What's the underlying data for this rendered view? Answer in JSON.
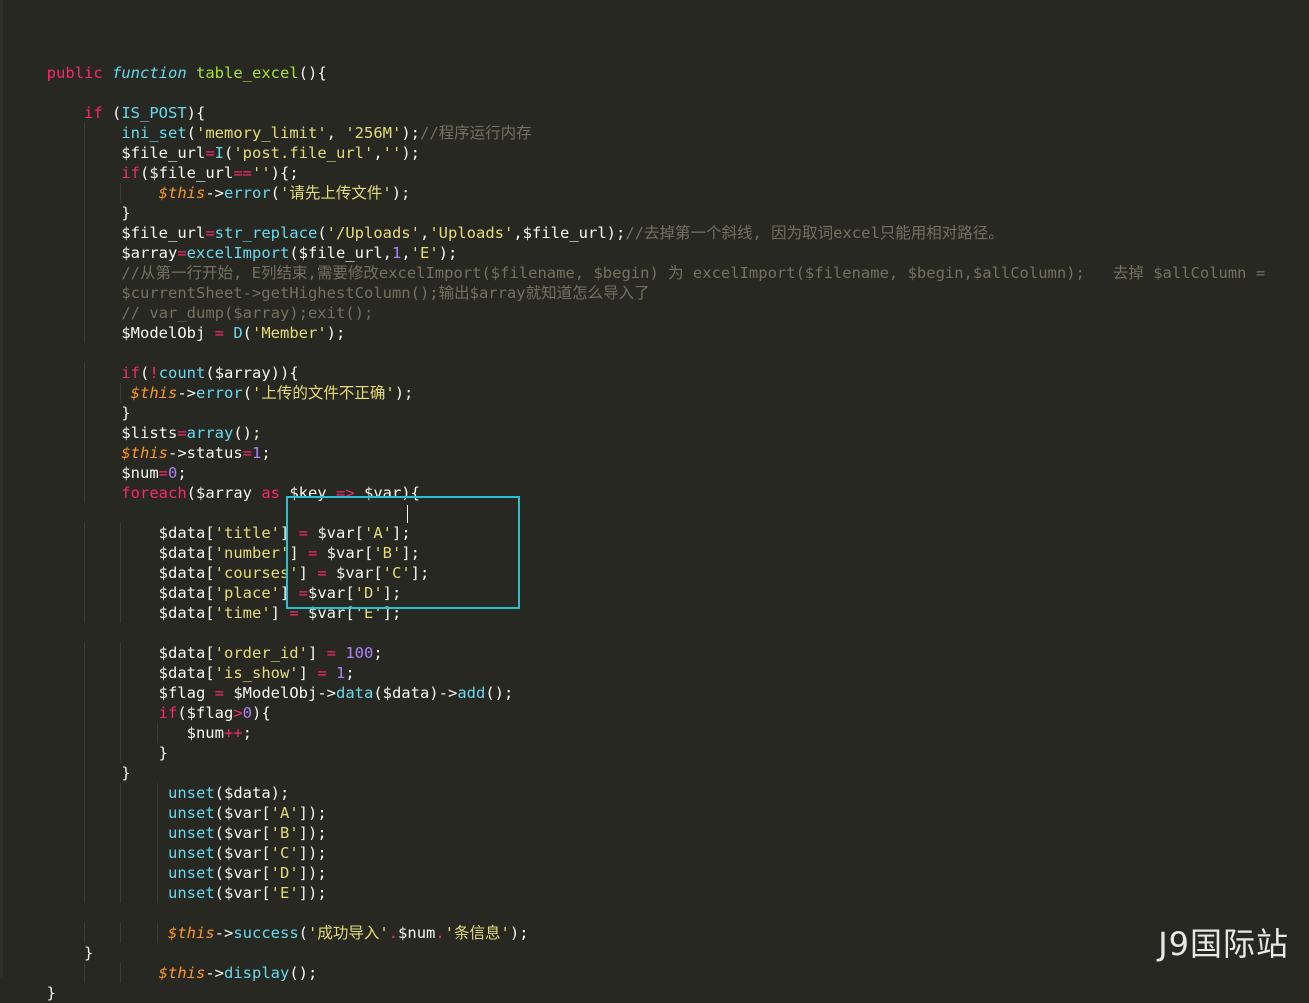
{
  "code_lines": [
    [],
    [
      [
        "kw",
        "public "
      ],
      [
        "fi",
        "function "
      ],
      [
        "def",
        "table_excel"
      ],
      [
        "txt",
        "(){"
      ]
    ],
    [],
    [
      [
        "txt",
        "    "
      ],
      [
        "kw",
        "if "
      ],
      [
        "txt",
        "("
      ],
      [
        "fn",
        "IS_POST"
      ],
      [
        "txt",
        "){"
      ]
    ],
    [
      [
        "txt",
        "        "
      ],
      [
        "fn",
        "ini_set"
      ],
      [
        "txt",
        "("
      ],
      [
        "str",
        "'memory_limit'"
      ],
      [
        "txt",
        ", "
      ],
      [
        "str",
        "'256M'"
      ],
      [
        "txt",
        ");"
      ],
      [
        "cmt",
        "//程序运行内存"
      ]
    ],
    [
      [
        "txt",
        "        $file_url"
      ],
      [
        "kw",
        "="
      ],
      [
        "fn",
        "I"
      ],
      [
        "txt",
        "("
      ],
      [
        "str",
        "'post.file_url'"
      ],
      [
        "txt",
        ","
      ],
      [
        "str",
        "''"
      ],
      [
        "txt",
        ");"
      ]
    ],
    [
      [
        "txt",
        "        "
      ],
      [
        "kw",
        "if"
      ],
      [
        "txt",
        "($file_url"
      ],
      [
        "kw",
        "=="
      ],
      [
        "str",
        "''"
      ],
      [
        "txt",
        "){;"
      ]
    ],
    [
      [
        "txt",
        "            "
      ],
      [
        "thi",
        "$this"
      ],
      [
        "txt",
        "->"
      ],
      [
        "fn",
        "error"
      ],
      [
        "txt",
        "("
      ],
      [
        "str",
        "'请先上传文件'"
      ],
      [
        "txt",
        ");"
      ]
    ],
    [
      [
        "txt",
        "        }"
      ]
    ],
    [
      [
        "txt",
        "        $file_url"
      ],
      [
        "kw",
        "="
      ],
      [
        "fn",
        "str_replace"
      ],
      [
        "txt",
        "("
      ],
      [
        "str",
        "'/Uploads'"
      ],
      [
        "txt",
        ","
      ],
      [
        "str",
        "'Uploads'"
      ],
      [
        "txt",
        ",$file_url);"
      ],
      [
        "cmt",
        "//去掉第一个斜线, 因为取词excel只能用相对路径。"
      ]
    ],
    [
      [
        "txt",
        "        $array"
      ],
      [
        "kw",
        "="
      ],
      [
        "fn",
        "excelImport"
      ],
      [
        "txt",
        "($file_url,"
      ],
      [
        "num",
        "1"
      ],
      [
        "txt",
        ","
      ],
      [
        "str",
        "'E'"
      ],
      [
        "txt",
        ");"
      ]
    ],
    [
      [
        "txt",
        "        "
      ],
      [
        "cmt",
        "//从第一行开始, E列结束,需要修改excelImport($filename, $begin) 为 excelImport($filename, $begin,$allColumn);   去掉 $allColumn ="
      ]
    ],
    [
      [
        "txt",
        "        "
      ],
      [
        "cmt",
        "$currentSheet->getHighestColumn();输出$array就知道怎么导入了"
      ]
    ],
    [
      [
        "txt",
        "        "
      ],
      [
        "cmt",
        "// var_dump($array);exit();"
      ]
    ],
    [
      [
        "txt",
        "        $ModelObj "
      ],
      [
        "kw",
        "= "
      ],
      [
        "fn",
        "D"
      ],
      [
        "txt",
        "("
      ],
      [
        "str",
        "'Member'"
      ],
      [
        "txt",
        ");"
      ]
    ],
    [],
    [
      [
        "txt",
        "        "
      ],
      [
        "kw",
        "if"
      ],
      [
        "txt",
        "("
      ],
      [
        "kw",
        "!"
      ],
      [
        "fn",
        "count"
      ],
      [
        "txt",
        "($array)){"
      ]
    ],
    [
      [
        "txt",
        "         "
      ],
      [
        "thi",
        "$this"
      ],
      [
        "txt",
        "->"
      ],
      [
        "fn",
        "error"
      ],
      [
        "txt",
        "("
      ],
      [
        "str",
        "'上传的文件不正确'"
      ],
      [
        "txt",
        ");"
      ]
    ],
    [
      [
        "txt",
        "        }"
      ]
    ],
    [
      [
        "txt",
        "        $lists"
      ],
      [
        "kw",
        "="
      ],
      [
        "fn",
        "array"
      ],
      [
        "txt",
        "();"
      ]
    ],
    [
      [
        "txt",
        "        "
      ],
      [
        "thi",
        "$this"
      ],
      [
        "txt",
        "->status"
      ],
      [
        "kw",
        "="
      ],
      [
        "num",
        "1"
      ],
      [
        "txt",
        ";"
      ]
    ],
    [
      [
        "txt",
        "        $num"
      ],
      [
        "kw",
        "="
      ],
      [
        "num",
        "0"
      ],
      [
        "txt",
        ";"
      ]
    ],
    [
      [
        "txt",
        "        "
      ],
      [
        "kw",
        "foreach"
      ],
      [
        "txt",
        "($array "
      ],
      [
        "kw",
        "as "
      ],
      [
        "txt",
        "$key "
      ],
      [
        "kw",
        "=> "
      ],
      [
        "txt",
        "$var){"
      ]
    ],
    [],
    [
      [
        "txt",
        "            $data["
      ],
      [
        "str",
        "'title'"
      ],
      [
        "txt",
        "] "
      ],
      [
        "kw",
        "= "
      ],
      [
        "txt",
        "$var["
      ],
      [
        "str",
        "'A'"
      ],
      [
        "txt",
        "];"
      ]
    ],
    [
      [
        "txt",
        "            $data["
      ],
      [
        "str",
        "'number'"
      ],
      [
        "txt",
        "] "
      ],
      [
        "kw",
        "= "
      ],
      [
        "txt",
        "$var["
      ],
      [
        "str",
        "'B'"
      ],
      [
        "txt",
        "];"
      ]
    ],
    [
      [
        "txt",
        "            $data["
      ],
      [
        "str",
        "'courses'"
      ],
      [
        "txt",
        "] "
      ],
      [
        "kw",
        "= "
      ],
      [
        "txt",
        "$var["
      ],
      [
        "str",
        "'C'"
      ],
      [
        "txt",
        "];"
      ]
    ],
    [
      [
        "txt",
        "            $data["
      ],
      [
        "str",
        "'place'"
      ],
      [
        "txt",
        "] "
      ],
      [
        "kw",
        "="
      ],
      [
        "txt",
        "$var["
      ],
      [
        "str",
        "'D'"
      ],
      [
        "txt",
        "];"
      ]
    ],
    [
      [
        "txt",
        "            $data["
      ],
      [
        "str",
        "'time'"
      ],
      [
        "txt",
        "] "
      ],
      [
        "kw",
        "= "
      ],
      [
        "txt",
        "$var["
      ],
      [
        "str",
        "'E'"
      ],
      [
        "txt",
        "];"
      ]
    ],
    [],
    [
      [
        "txt",
        "            $data["
      ],
      [
        "str",
        "'order_id'"
      ],
      [
        "txt",
        "] "
      ],
      [
        "kw",
        "= "
      ],
      [
        "num",
        "100"
      ],
      [
        "txt",
        ";"
      ]
    ],
    [
      [
        "txt",
        "            $data["
      ],
      [
        "str",
        "'is_show'"
      ],
      [
        "txt",
        "] "
      ],
      [
        "kw",
        "= "
      ],
      [
        "num",
        "1"
      ],
      [
        "txt",
        ";"
      ]
    ],
    [
      [
        "txt",
        "            $flag "
      ],
      [
        "kw",
        "= "
      ],
      [
        "txt",
        "$ModelObj->"
      ],
      [
        "fn",
        "data"
      ],
      [
        "txt",
        "($data)->"
      ],
      [
        "fn",
        "add"
      ],
      [
        "txt",
        "();"
      ]
    ],
    [
      [
        "txt",
        "            "
      ],
      [
        "kw",
        "if"
      ],
      [
        "txt",
        "($flag"
      ],
      [
        "kw",
        ">"
      ],
      [
        "num",
        "0"
      ],
      [
        "txt",
        "){"
      ]
    ],
    [
      [
        "txt",
        "               $num"
      ],
      [
        "kw",
        "++"
      ],
      [
        "txt",
        ";"
      ]
    ],
    [
      [
        "txt",
        "            }"
      ]
    ],
    [
      [
        "txt",
        "        }"
      ]
    ],
    [
      [
        "txt",
        "             "
      ],
      [
        "fn",
        "unset"
      ],
      [
        "txt",
        "($data);"
      ]
    ],
    [
      [
        "txt",
        "             "
      ],
      [
        "fn",
        "unset"
      ],
      [
        "txt",
        "($var["
      ],
      [
        "str",
        "'A'"
      ],
      [
        "txt",
        "]);"
      ]
    ],
    [
      [
        "txt",
        "             "
      ],
      [
        "fn",
        "unset"
      ],
      [
        "txt",
        "($var["
      ],
      [
        "str",
        "'B'"
      ],
      [
        "txt",
        "]);"
      ]
    ],
    [
      [
        "txt",
        "             "
      ],
      [
        "fn",
        "unset"
      ],
      [
        "txt",
        "($var["
      ],
      [
        "str",
        "'C'"
      ],
      [
        "txt",
        "]);"
      ]
    ],
    [
      [
        "txt",
        "             "
      ],
      [
        "fn",
        "unset"
      ],
      [
        "txt",
        "($var["
      ],
      [
        "str",
        "'D'"
      ],
      [
        "txt",
        "]);"
      ]
    ],
    [
      [
        "txt",
        "             "
      ],
      [
        "fn",
        "unset"
      ],
      [
        "txt",
        "($var["
      ],
      [
        "str",
        "'E'"
      ],
      [
        "txt",
        "]);"
      ]
    ],
    [],
    [
      [
        "txt",
        "             "
      ],
      [
        "thi",
        "$this"
      ],
      [
        "txt",
        "->"
      ],
      [
        "fn",
        "success"
      ],
      [
        "txt",
        "("
      ],
      [
        "str",
        "'成功导入'"
      ],
      [
        "kw",
        "."
      ],
      [
        "txt",
        "$num"
      ],
      [
        "kw",
        "."
      ],
      [
        "str",
        "'条信息'"
      ],
      [
        "txt",
        ");"
      ]
    ],
    [
      [
        "txt",
        "    }"
      ]
    ],
    [
      [
        "txt",
        "            "
      ],
      [
        "thi",
        "$this"
      ],
      [
        "txt",
        "->"
      ],
      [
        "fn",
        "display"
      ],
      [
        "txt",
        "();"
      ]
    ],
    [
      [
        "txt",
        "}"
      ]
    ]
  ],
  "colors": {
    "background": "#272822",
    "keyword": "#f92672",
    "function": "#66d9ef",
    "string": "#e6db74",
    "number": "#ae81ff",
    "comment": "#75715e",
    "this": "#fd971f",
    "definition": "#a6e22e",
    "highlight_box": "#22c3d3"
  },
  "watermark": "J9国际站"
}
